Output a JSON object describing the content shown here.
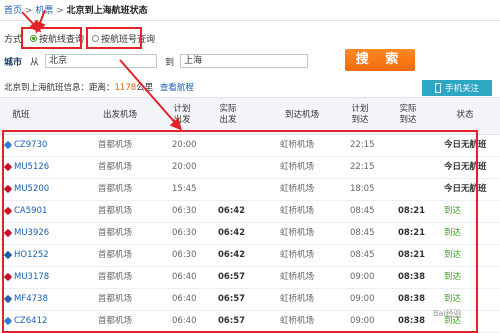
{
  "breadcrumb": {
    "home": "首页",
    "sep1": ">",
    "flights": "机票",
    "sep2": ">",
    "current": "北京到上海航班状态"
  },
  "search_mode": {
    "label": "方式",
    "option1": "按航线查询",
    "option2": "按航班号查询"
  },
  "city_row": {
    "label": "城市",
    "from_label": "从",
    "from_value": "北京",
    "to_label": "到",
    "to_value": "上海",
    "search_button": "搜 索"
  },
  "info": {
    "prefix": "北京到上海航班信息：距离：",
    "distance": "1178",
    "unit": "公里",
    "route_link": "查看航程"
  },
  "follow_button": "手机关注",
  "columns": {
    "flight": "航班",
    "dep_airport": "出发机场",
    "plan_dep_1": "计划",
    "plan_dep_2": "出发",
    "act_dep_1": "实际",
    "act_dep_2": "出发",
    "arr_airport": "到达机场",
    "plan_arr_1": "计划",
    "plan_arr_2": "到达",
    "act_arr_1": "实际",
    "act_arr_2": "到达",
    "status": "状态"
  },
  "rows": [
    {
      "flight": "CZ9730",
      "dep": "首都机场",
      "plan_dep": "20:00",
      "act_dep": "",
      "arr": "虹桥机场",
      "plan_arr": "22:15",
      "act_arr": "",
      "status": "今日无航班",
      "logo_color": "#2b7fd1"
    },
    {
      "flight": "MU5126",
      "dep": "首都机场",
      "plan_dep": "20:00",
      "act_dep": "",
      "arr": "虹桥机场",
      "plan_arr": "22:15",
      "act_arr": "",
      "status": "今日无航班",
      "logo_color": "#c8102e"
    },
    {
      "flight": "MU5200",
      "dep": "首都机场",
      "plan_dep": "15:45",
      "act_dep": "",
      "arr": "虹桥机场",
      "plan_arr": "18:05",
      "act_arr": "",
      "status": "今日无航班",
      "logo_color": "#c8102e"
    },
    {
      "flight": "CA5901",
      "dep": "首都机场",
      "plan_dep": "06:30",
      "act_dep": "06:42",
      "arr": "虹桥机场",
      "plan_arr": "08:45",
      "act_arr": "08:21",
      "status": "到达",
      "logo_color": "#d4141c"
    },
    {
      "flight": "MU3926",
      "dep": "首都机场",
      "plan_dep": "06:30",
      "act_dep": "06:42",
      "arr": "虹桥机场",
      "plan_arr": "08:45",
      "act_arr": "08:21",
      "status": "到达",
      "logo_color": "#c8102e"
    },
    {
      "flight": "HO1252",
      "dep": "首都机场",
      "plan_dep": "06:30",
      "act_dep": "06:42",
      "arr": "虹桥机场",
      "plan_arr": "08:45",
      "act_arr": "08:21",
      "status": "到达",
      "logo_color": "#1e5aa8"
    },
    {
      "flight": "MU3178",
      "dep": "首都机场",
      "plan_dep": "06:40",
      "act_dep": "06:57",
      "arr": "虹桥机场",
      "plan_arr": "09:00",
      "act_arr": "08:38",
      "status": "到达",
      "logo_color": "#c8102e"
    },
    {
      "flight": "MF4738",
      "dep": "首都机场",
      "plan_dep": "06:40",
      "act_dep": "06:57",
      "arr": "虹桥机场",
      "plan_arr": "09:00",
      "act_arr": "08:38",
      "status": "到达",
      "logo_color": "#2b5fa8"
    },
    {
      "flight": "CZ6412",
      "dep": "首都机场",
      "plan_dep": "06:40",
      "act_dep": "06:57",
      "arr": "虹桥机场",
      "plan_arr": "09:00",
      "act_arr": "08:38",
      "status": "到达",
      "logo_color": "#2b7fd1"
    }
  ],
  "colors": {
    "annotation_red": "#e2232a",
    "link_blue": "#1a5fb4",
    "status_green": "#38a11f",
    "button_orange": "#ef6a0a",
    "follow_teal": "#2da7c4"
  },
  "watermark": "Bai经验"
}
